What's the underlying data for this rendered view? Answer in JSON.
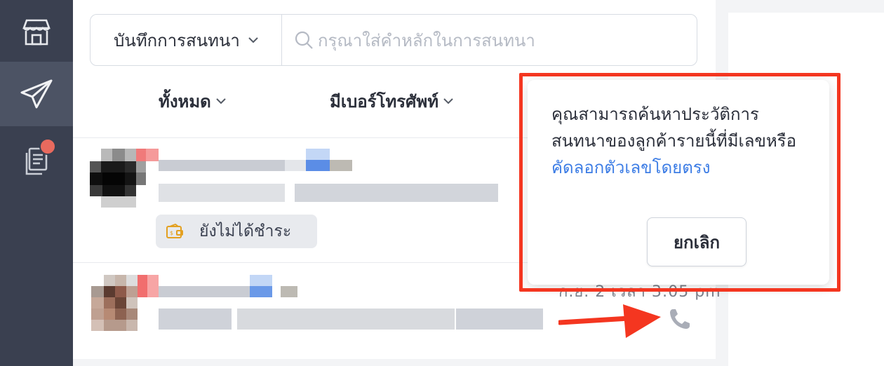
{
  "sidebar": {
    "items": [
      {
        "icon": "store-icon"
      },
      {
        "icon": "paper-plane-icon",
        "active": true
      },
      {
        "icon": "documents-icon",
        "has_badge": true
      }
    ]
  },
  "search": {
    "select_label": "บันทึกการสนทนา",
    "placeholder": "กรุณาใส่คำหลักในการสนทนา"
  },
  "filters": [
    {
      "label": "ทั้งหมด"
    },
    {
      "label": "มีเบอร์โทรศัพท์"
    }
  ],
  "conversations": [
    {
      "tag_label": "ยังไม่ได้ชำระ"
    },
    {
      "time": "ก.ย. 2 เวลา 3:05 pm"
    }
  ],
  "popover": {
    "message_text": "คุณสามารถค้นหาประวัติการสนทนาของลูกค้ารายนี้ที่มีเลขหรือ",
    "message_link": "คัดลอกตัวเลขโดยตรง",
    "cancel_label": "ยกเลิก"
  },
  "colors": {
    "sidebar_bg": "#3a4050",
    "highlight": "#f43620",
    "link": "#3d7de5",
    "badge": "#e86a5e"
  }
}
